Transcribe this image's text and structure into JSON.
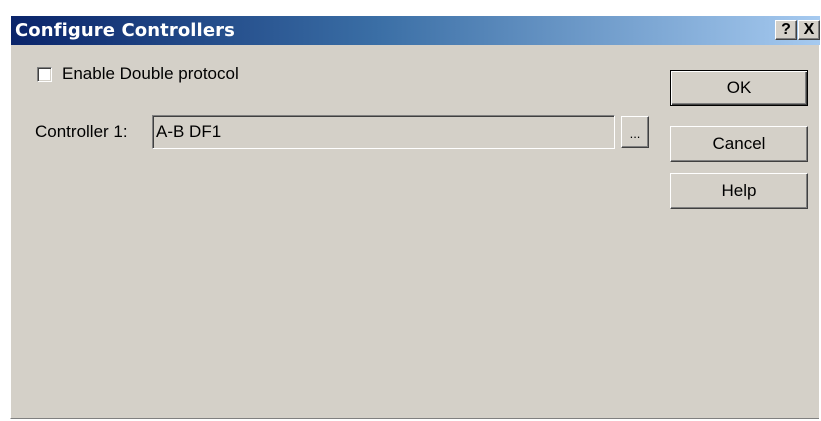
{
  "window": {
    "title": "Configure Controllers",
    "help_glyph": "?",
    "close_glyph": "X"
  },
  "options": {
    "double_protocol_label": "Enable Double protocol",
    "double_protocol_checked": false
  },
  "controller": {
    "label": "Controller 1:",
    "value": "A-B DF1",
    "browse_label": "..."
  },
  "buttons": {
    "ok": "OK",
    "cancel": "Cancel",
    "help": "Help"
  },
  "colors": {
    "title_gradient_start": "#0a246a",
    "title_gradient_end": "#a6caf0",
    "face": "#d4d0c8"
  }
}
